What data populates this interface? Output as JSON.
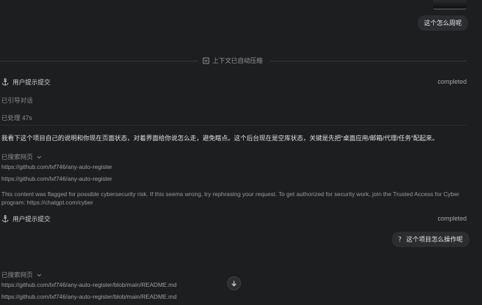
{
  "top_bubble": "这个怎么周呢",
  "divider": {
    "label": "上下文已自动压缩"
  },
  "turn1": {
    "header": "用户提示提交",
    "status": "completed",
    "guided": "已引导对话",
    "processed": "已处理 47s",
    "message": "我看下这个项目自己的说明和你现在页面状态，对着界面给你说怎么走，避免瞎点。这个后台现在是空库状态，关键是先把“桌面应用/邮箱/代理/任务”配起来。",
    "search_label": "已搜索网页",
    "links": [
      "https://github.com/lxf746/any-auto-register",
      "https://github.com/lxf746/any-auto-register"
    ],
    "flagged": "This content was flagged for possible cybersecurity risk. If this seems wrong, try rephrasing your request. To get authorized for security work, join the Trusted Access for Cyber program: https://chatgpt.com/cyber"
  },
  "turn2": {
    "header": "用户提示提交",
    "status": "completed",
    "bubble": "？ 这个项目怎么操作呢",
    "search_label": "已搜索网页",
    "links": [
      "https://github.com/lxf746/any-auto-register/blob/main/README.md",
      "https://github.com/lxf746/any-auto-register/blob/main/README.md"
    ]
  },
  "icons": {
    "anchor": "anchor-icon",
    "compress": "compress-icon",
    "chevron": "chevron-down-icon",
    "scroll_down": "arrow-down-icon"
  },
  "colors": {
    "background": "#1d1e20",
    "bubble": "#2c2d30",
    "text": "#d6d6d6",
    "muted": "#8c8c8c"
  }
}
